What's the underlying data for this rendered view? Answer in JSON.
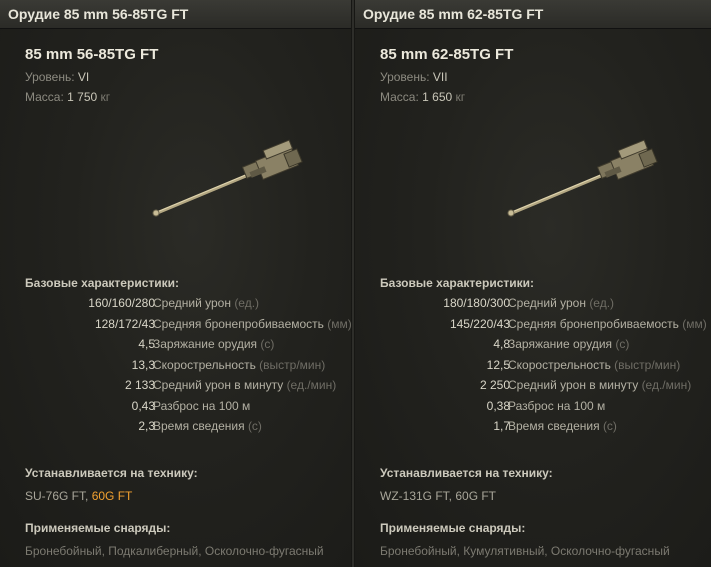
{
  "panels": [
    {
      "header": "Орудие 85 mm 56-85TG FT",
      "name": "85 mm 56-85TG FT",
      "level_label": "Уровень:",
      "level_value": "VI",
      "mass_label": "Масса:",
      "mass_value": "1 750",
      "mass_unit": "кг",
      "icon": "gun-icon",
      "stats_title": "Базовые характеристики:",
      "stats": [
        {
          "value": "160/160/280",
          "label": "Средний урон",
          "unit": "(ед.)"
        },
        {
          "value": "128/172/43",
          "label": "Средняя бронепробиваемость",
          "unit": "(мм)"
        },
        {
          "value": "4,5",
          "label": "Заряжание орудия",
          "unit": "(с)"
        },
        {
          "value": "13,3",
          "label": "Скорострельность",
          "unit": "(выстр/мин)"
        },
        {
          "value": "2 133",
          "label": "Средний урон в минуту",
          "unit": "(ед./мин)"
        },
        {
          "value": "0,43",
          "label": "Разброс на 100 м",
          "unit": ""
        },
        {
          "value": "2,3",
          "label": "Время сведения",
          "unit": "(с)"
        }
      ],
      "vehicles_title": "Устанавливается на технику:",
      "vehicles": [
        "SU-76G FT, ",
        "60G FT"
      ],
      "ammo_title": "Применяемые снаряды:",
      "ammo": "Бронебойный, Подкалиберный, Осколочно-фугасный"
    },
    {
      "header": "Орудие 85 mm 62-85TG FT",
      "name": "85 mm 62-85TG FT",
      "level_label": "Уровень:",
      "level_value": "VII",
      "mass_label": "Масса:",
      "mass_value": "1 650",
      "mass_unit": "кг",
      "icon": "gun-icon",
      "stats_title": "Базовые характеристики:",
      "stats": [
        {
          "value": "180/180/300",
          "label": "Средний урон",
          "unit": "(ед.)"
        },
        {
          "value": "145/220/43",
          "label": "Средняя бронепробиваемость",
          "unit": "(мм)"
        },
        {
          "value": "4,8",
          "label": "Заряжание орудия",
          "unit": "(с)"
        },
        {
          "value": "12,5",
          "label": "Скорострельность",
          "unit": "(выстр/мин)"
        },
        {
          "value": "2 250",
          "label": "Средний урон в минуту",
          "unit": "(ед./мин)"
        },
        {
          "value": "0,38",
          "label": "Разброс на 100 м",
          "unit": ""
        },
        {
          "value": "1,7",
          "label": "Время сведения",
          "unit": "(с)"
        }
      ],
      "vehicles_title": "Устанавливается на технику:",
      "vehicles": [
        "WZ-131G FT, 60G FT",
        ""
      ],
      "ammo_title": "Применяемые снаряды:",
      "ammo": "Бронебойный, Кумулятивный, Осколочно-фугасный"
    }
  ],
  "colors": {
    "highlight": "#f2a130",
    "background": "#1c1c19"
  }
}
